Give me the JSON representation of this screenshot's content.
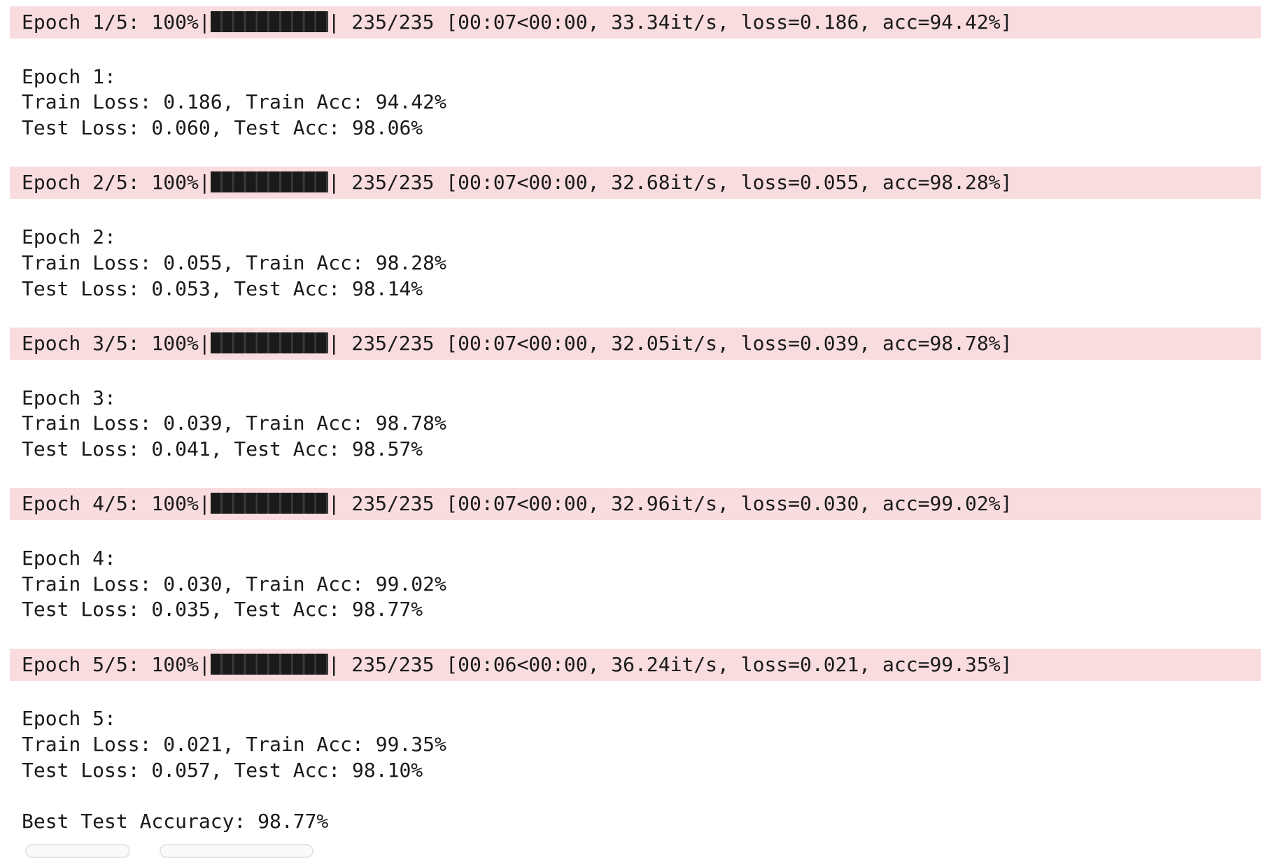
{
  "output": {
    "epochs": [
      {
        "progress": {
          "prefix": "Epoch 1/5: 100%|",
          "suffix": "| 235/235 [00:07<00:00, 33.34it/s, loss=0.186, acc=94.42%]",
          "fraction": 1.0
        },
        "header": "Epoch 1:",
        "train": "Train Loss: 0.186, Train Acc: 94.42%",
        "test": "Test Loss: 0.060, Test Acc: 98.06%"
      },
      {
        "progress": {
          "prefix": "Epoch 2/5: 100%|",
          "suffix": "| 235/235 [00:07<00:00, 32.68it/s, loss=0.055, acc=98.28%]",
          "fraction": 1.0
        },
        "header": "Epoch 2:",
        "train": "Train Loss: 0.055, Train Acc: 98.28%",
        "test": "Test Loss: 0.053, Test Acc: 98.14%"
      },
      {
        "progress": {
          "prefix": "Epoch 3/5: 100%|",
          "suffix": "| 235/235 [00:07<00:00, 32.05it/s, loss=0.039, acc=98.78%]",
          "fraction": 1.0
        },
        "header": "Epoch 3:",
        "train": "Train Loss: 0.039, Train Acc: 98.78%",
        "test": "Test Loss: 0.041, Test Acc: 98.57%"
      },
      {
        "progress": {
          "prefix": "Epoch 4/5: 100%|",
          "suffix": "| 235/235 [00:07<00:00, 32.96it/s, loss=0.030, acc=99.02%]",
          "fraction": 1.0
        },
        "header": "Epoch 4:",
        "train": "Train Loss: 0.030, Train Acc: 99.02%",
        "test": "Test Loss: 0.035, Test Acc: 98.77%"
      },
      {
        "progress": {
          "prefix": "Epoch 5/5: 100%|",
          "suffix": "| 235/235 [00:06<00:00, 36.24it/s, loss=0.021, acc=99.35%]",
          "fraction": 1.0
        },
        "header": "Epoch 5:",
        "train": "Train Loss: 0.021, Train Acc: 99.35%",
        "test": "Test Loss: 0.057, Test Acc: 98.10%"
      }
    ],
    "best": "Best Test Accuracy: 98.77%"
  },
  "colors": {
    "progress_bg": "#f8dcde",
    "text": "#1a1a1a"
  }
}
